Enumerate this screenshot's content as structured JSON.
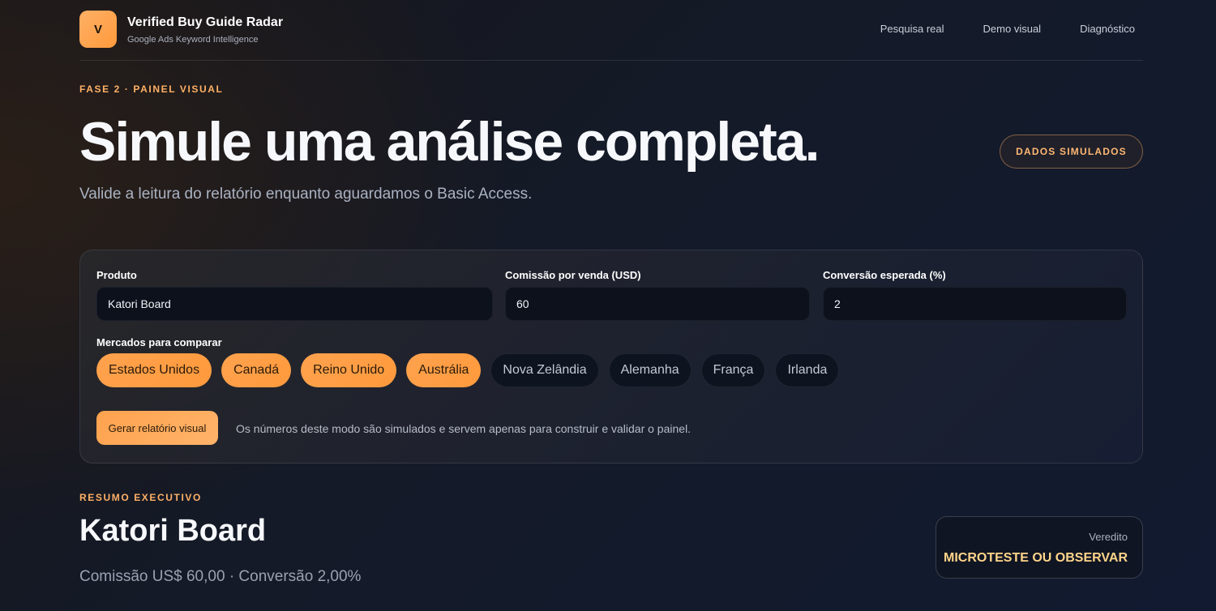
{
  "brand": {
    "logo_letter": "V",
    "title": "Verified Buy Guide Radar",
    "subtitle": "Google Ads Keyword Intelligence"
  },
  "nav": [
    "Pesquisa real",
    "Demo visual",
    "Diagnóstico"
  ],
  "hero": {
    "eyebrow": "FASE 2 · PAINEL VISUAL",
    "title": "Simule uma análise completa.",
    "subtitle": "Valide a leitura do relatório enquanto aguardamos o Basic Access.",
    "badge": "DADOS SIMULADOS"
  },
  "form": {
    "product": {
      "label": "Produto",
      "value": "Katori Board"
    },
    "commission": {
      "label": "Comissão por venda (USD)",
      "value": "60"
    },
    "conversion": {
      "label": "Conversão esperada (%)",
      "value": "2"
    },
    "markets_label": "Mercados para comparar",
    "markets": [
      {
        "name": "Estados Unidos",
        "selected": true
      },
      {
        "name": "Canadá",
        "selected": true
      },
      {
        "name": "Reino Unido",
        "selected": true
      },
      {
        "name": "Austrália",
        "selected": true
      },
      {
        "name": "Nova Zelândia",
        "selected": false
      },
      {
        "name": "Alemanha",
        "selected": false
      },
      {
        "name": "França",
        "selected": false
      },
      {
        "name": "Irlanda",
        "selected": false
      }
    ],
    "generate_label": "Gerar relatório visual",
    "note": "Os números deste modo são simulados e servem apenas para construir e validar o painel."
  },
  "summary": {
    "eyebrow": "RESUMO EXECUTIVO",
    "title": "Katori Board",
    "meta": "Comissão US$ 60,00 · Conversão 2,00%",
    "verdict_label": "Veredito",
    "verdict_value": "MICROTESTE OU OBSERVAR"
  },
  "colors": {
    "accent": "#ff9a3c",
    "accent_text": "#ffb066",
    "verdict": "#ffd58a"
  }
}
